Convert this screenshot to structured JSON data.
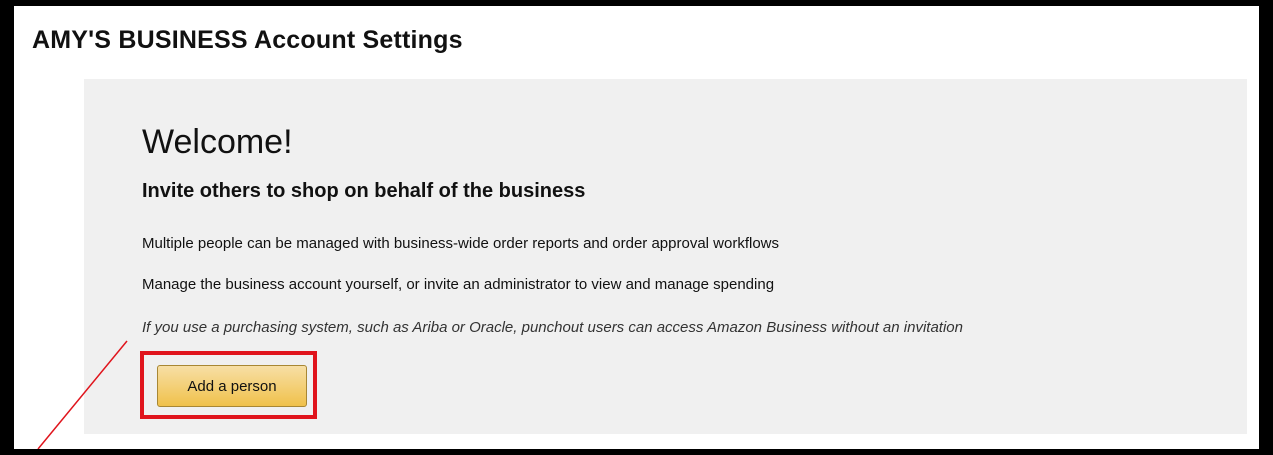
{
  "header": {
    "title": "AMY'S BUSINESS Account Settings"
  },
  "welcome_panel": {
    "heading": "Welcome!",
    "subheading": "Invite others to shop on behalf of the business",
    "lines": [
      "Multiple people can be managed with business-wide order reports and order approval workflows",
      "Manage the business account yourself, or invite an administrator to view and manage spending",
      "If you use a purchasing system, such as Ariba or Oracle, punchout users can access Amazon Business without an invitation"
    ],
    "add_person_label": "Add a person"
  },
  "colors": {
    "panel_background": "#f0f0f0",
    "button_gradient_top": "#f7dfa5",
    "button_gradient_bottom": "#f0c14b",
    "highlight_border": "#e0141c",
    "pointer_line": "#e0141c"
  }
}
